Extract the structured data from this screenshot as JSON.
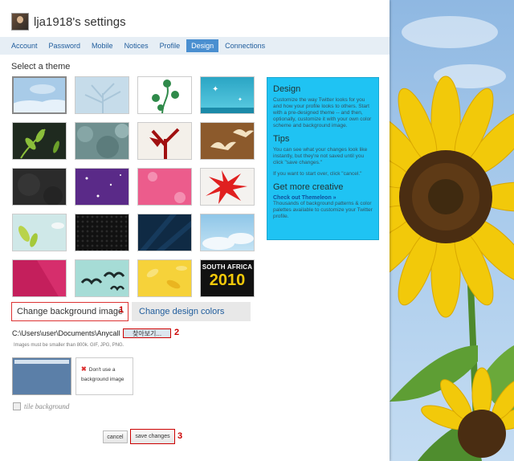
{
  "header": {
    "title": "lja1918's settings"
  },
  "tabs": [
    {
      "label": "Account"
    },
    {
      "label": "Password"
    },
    {
      "label": "Mobile"
    },
    {
      "label": "Notices"
    },
    {
      "label": "Profile"
    },
    {
      "label": "Design",
      "active": true
    },
    {
      "label": "Connections"
    }
  ],
  "section_title": "Select a theme",
  "themes": [
    {
      "name": "sky-clouds",
      "bg": "#a8cbe8"
    },
    {
      "name": "bare-tree",
      "bg": "#c6dcea"
    },
    {
      "name": "green-vines",
      "bg": "#ffffff"
    },
    {
      "name": "cyan-stars",
      "bg": "#2ba5c4"
    },
    {
      "name": "green-leaves-dark",
      "bg": "#1f2a1f"
    },
    {
      "name": "teal-foliage",
      "bg": "#6f8f8f"
    },
    {
      "name": "red-branch",
      "bg": "#f4f0ea"
    },
    {
      "name": "brown-birds",
      "bg": "#8c5a2c"
    },
    {
      "name": "dark-grunge",
      "bg": "#2b2b2b"
    },
    {
      "name": "purple-stars",
      "bg": "#5a2a88"
    },
    {
      "name": "pink-flowers",
      "bg": "#ec5c8c"
    },
    {
      "name": "red-leaf",
      "bg": "#f4f2ef"
    },
    {
      "name": "light-leaves",
      "bg": "#cfe8e8"
    },
    {
      "name": "black-mesh",
      "bg": "#111111"
    },
    {
      "name": "navy-rays",
      "bg": "#0f2a44"
    },
    {
      "name": "blue-sky",
      "bg": "#8fc6e8"
    },
    {
      "name": "magenta-stripe",
      "bg": "#c41f5c"
    },
    {
      "name": "teal-birds",
      "bg": "#a6dcd6"
    },
    {
      "name": "yellow-leaves",
      "bg": "#f6d23a"
    },
    {
      "name": "south-africa",
      "bg": "#111111"
    }
  ],
  "south_africa": {
    "line1": "SOUTH AFRICA",
    "line2": "2010"
  },
  "sidebar": {
    "design_title": "Design",
    "design_text": "Customize the way Twitter looks for you and how your profile looks to others. Start with a pre-designed theme -- and then, optionally, customize it with your own color scheme and background image.",
    "tips_title": "Tips",
    "tips_text1": "You can see what your changes look like instantly, but they're not saved until you click \"save changes.\"",
    "tips_text2": "If you want to start over, click \"cancel.\"",
    "creative_title": "Get more creative",
    "creative_link": "Check out Themeleon »",
    "creative_text": "Thousands of background patterns & color palettes available to customize your Twitter profile."
  },
  "options": {
    "bg_image_label": "Change background image",
    "colors_label": "Change design colors"
  },
  "upload": {
    "path": "C:\\Users\\user\\Documents\\Anycall P",
    "browse_label": "찾아보기...",
    "hint": "Images must be smaller than 800k. GIF, JPG, PNG."
  },
  "no_bg": {
    "x": "✖",
    "label": "Don't use a background image"
  },
  "tile": {
    "label": "tile background"
  },
  "buttons": {
    "cancel": "cancel",
    "save": "save changes"
  },
  "markers": [
    "1",
    "2",
    "3"
  ],
  "colors": {
    "accent": "#4a8fd0",
    "sidebar": "#1fc3f3",
    "link": "#1f5c9c",
    "marker": "#cc0000"
  }
}
